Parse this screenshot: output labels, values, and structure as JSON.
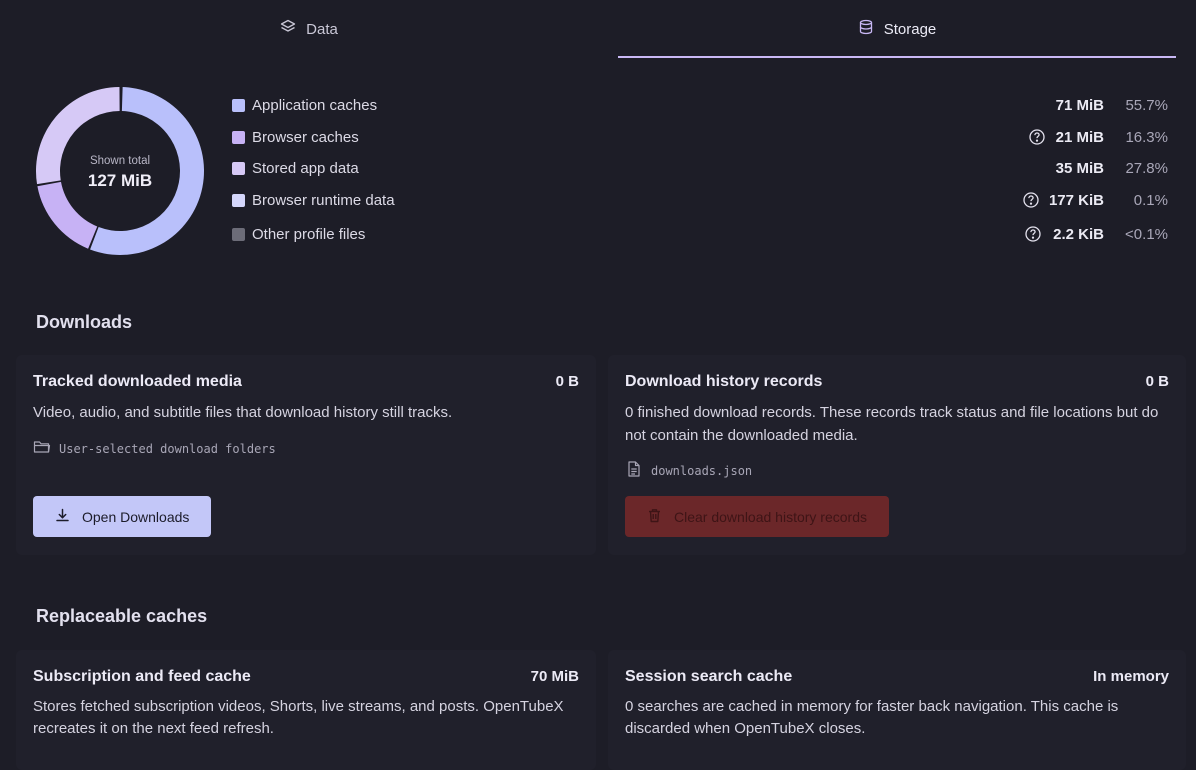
{
  "tabs": [
    {
      "label": "Data",
      "icon": "layers-icon"
    },
    {
      "label": "Storage",
      "icon": "database-icon",
      "active": true
    }
  ],
  "overview": {
    "total_label": "Shown total",
    "total_value": "127 MiB",
    "items": [
      {
        "name": "Application caches",
        "size": "71 MiB",
        "percent": "55.7%",
        "fraction": 0.557,
        "color": "#b9c0fb",
        "help": false
      },
      {
        "name": "Browser caches",
        "size": "21 MiB",
        "percent": "16.3%",
        "fraction": 0.163,
        "color": "#c7b2f5",
        "help": true
      },
      {
        "name": "Stored app data",
        "size": "35 MiB",
        "percent": "27.8%",
        "fraction": 0.278,
        "color": "#d6c9f6",
        "help": false
      },
      {
        "name": "Browser runtime data",
        "size": "177 KiB",
        "percent": "0.1%",
        "fraction": 0.001,
        "color": "#d4d6fb",
        "help": true
      },
      {
        "name": "Other profile files",
        "size": "2.2 KiB",
        "percent": "<0.1%",
        "fraction": 0.0,
        "color": "#6c6c78",
        "help": true
      }
    ]
  },
  "downloads": {
    "title": "Downloads",
    "tracked": {
      "title": "Tracked downloaded media",
      "size": "0 B",
      "description": "Video, audio, and subtitle files that download history still tracks.",
      "path": "User-selected download folders",
      "button": "Open Downloads"
    },
    "history": {
      "title": "Download history records",
      "size": "0 B",
      "description": "0 finished download records. These records track status and file locations but do not contain the downloaded media.",
      "path": "downloads.json",
      "button": "Clear download history records"
    }
  },
  "caches": {
    "title": "Replaceable caches",
    "subscription": {
      "title": "Subscription and feed cache",
      "size": "70 MiB",
      "description": "Stores fetched subscription videos, Shorts, live streams, and posts. OpenTubeX recreates it on the next feed refresh."
    },
    "session": {
      "title": "Session search cache",
      "size": "In memory",
      "description": "0 searches are cached in memory for faster back navigation. This cache is discarded when OpenTubeX closes."
    }
  }
}
